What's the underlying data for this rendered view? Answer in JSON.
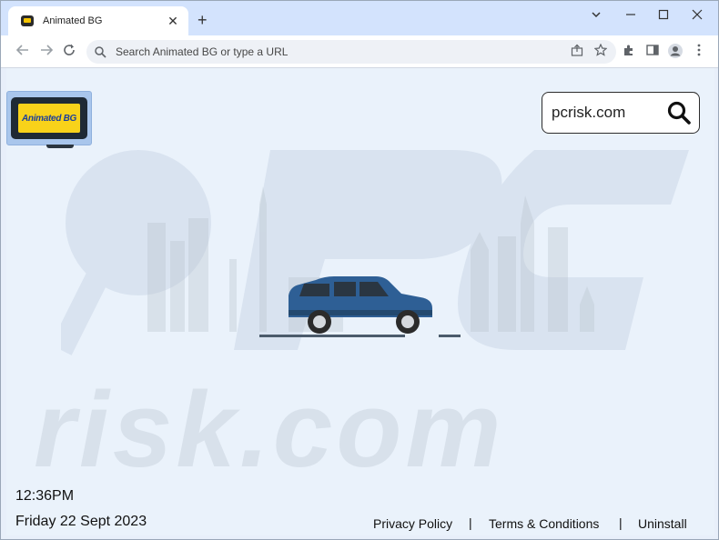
{
  "browser": {
    "tab_title": "Animated BG",
    "new_tab_symbol": "+",
    "omnibox_placeholder": "Search Animated BG or type a URL",
    "window_controls": {
      "dropdown": "⌄",
      "minimize": "—",
      "maximize": "☐",
      "close": "✕"
    }
  },
  "page": {
    "logo_text": "Animated BG",
    "search_value": "pcrisk.com",
    "time": "12:36PM",
    "date": "Friday 22 Sept 2023",
    "footer": {
      "privacy": "Privacy Policy",
      "terms": "Terms & Conditions",
      "uninstall": "Uninstall",
      "separator": "|"
    },
    "watermark_text": "risk.com"
  },
  "colors": {
    "tabstrip": "#d3e3fd",
    "page_bg": "#eaf2fb",
    "car_body": "#2e5f95",
    "logo_bg": "#f8d21a"
  },
  "icons": [
    "back-icon",
    "forward-icon",
    "reload-icon",
    "search-icon",
    "share-icon",
    "star-icon",
    "extensions-icon",
    "sidepanel-icon",
    "profile-icon",
    "menu-icon"
  ]
}
